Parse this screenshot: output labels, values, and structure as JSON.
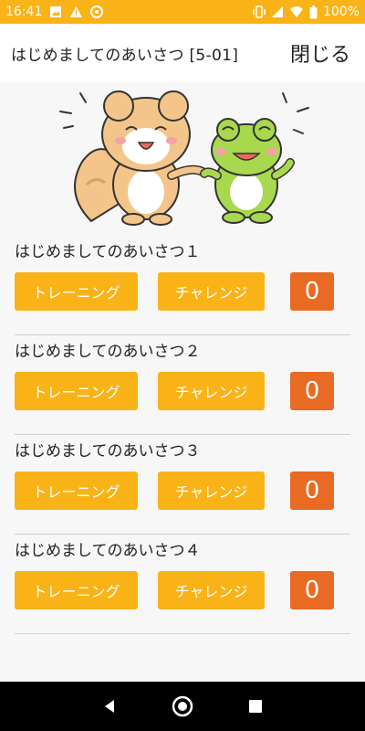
{
  "status_bar": {
    "time": "16:41",
    "battery": "100%",
    "left_icons": [
      "image-icon",
      "warning-icon",
      "chrome-icon"
    ],
    "right_icons": [
      "vibrate-icon",
      "signal-icon",
      "wifi-icon",
      "battery-icon"
    ]
  },
  "header": {
    "title": "はじめましてのあいさつ [5-01]",
    "close_label": "閉じる"
  },
  "illustration": {
    "description_icon": "squirrel-and-frog-icon"
  },
  "lessons": [
    {
      "title": "はじめましてのあいさつ１",
      "training_label": "トレーニング",
      "challenge_label": "チャレンジ",
      "score": "0"
    },
    {
      "title": "はじめましてのあいさつ２",
      "training_label": "トレーニング",
      "challenge_label": "チャレンジ",
      "score": "0"
    },
    {
      "title": "はじめましてのあいさつ３",
      "training_label": "トレーニング",
      "challenge_label": "チャレンジ",
      "score": "0"
    },
    {
      "title": "はじめましてのあいさつ４",
      "training_label": "トレーニング",
      "challenge_label": "チャレンジ",
      "score": "0"
    }
  ],
  "colors": {
    "accent": "#f9b317",
    "score_badge": "#e96a22",
    "nav_bar": "#000000"
  },
  "nav_bar": {
    "icons": [
      "back-icon",
      "home-icon",
      "recents-icon"
    ]
  }
}
